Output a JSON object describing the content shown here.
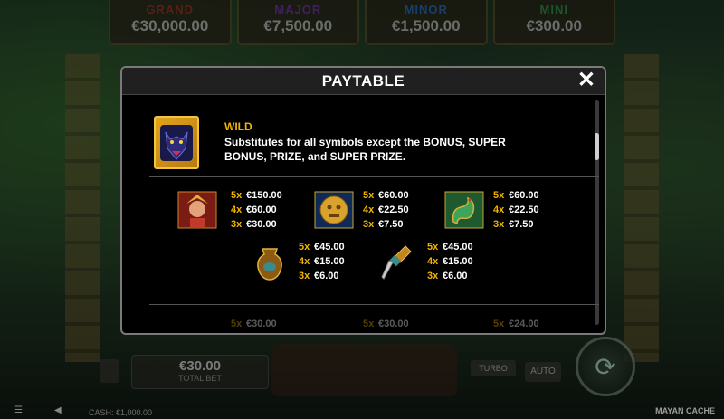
{
  "jackpots": [
    {
      "name": "GRAND",
      "value": "€30,000.00",
      "color": "#b0281d"
    },
    {
      "name": "MAJOR",
      "value": "€7,500.00",
      "color": "#7b2fb8"
    },
    {
      "name": "MINOR",
      "value": "€1,500.00",
      "color": "#2a6fd6"
    },
    {
      "name": "MINI",
      "value": "€300.00",
      "color": "#2ea14a"
    }
  ],
  "paytable": {
    "title": "PAYTABLE",
    "close_symbol": "✕",
    "wild": {
      "title": "WILD",
      "description": "Substitutes for all symbols except the BONUS, SUPER BONUS, PRIZE, and SUPER PRIZE.",
      "icon": "panther-icon"
    },
    "symbols": [
      {
        "icon": "queen-icon",
        "pays": [
          {
            "n": "5x",
            "v": "€150.00"
          },
          {
            "n": "4x",
            "v": "€60.00"
          },
          {
            "n": "3x",
            "v": "€30.00"
          }
        ]
      },
      {
        "icon": "gold-mask-icon",
        "pays": [
          {
            "n": "5x",
            "v": "€60.00"
          },
          {
            "n": "4x",
            "v": "€22.50"
          },
          {
            "n": "3x",
            "v": "€7.50"
          }
        ]
      },
      {
        "icon": "jade-snake-icon",
        "pays": [
          {
            "n": "5x",
            "v": "€60.00"
          },
          {
            "n": "4x",
            "v": "€22.50"
          },
          {
            "n": "3x",
            "v": "€7.50"
          }
        ]
      },
      {
        "icon": "vase-icon",
        "pays": [
          {
            "n": "5x",
            "v": "€45.00"
          },
          {
            "n": "4x",
            "v": "€15.00"
          },
          {
            "n": "3x",
            "v": "€6.00"
          }
        ]
      },
      {
        "icon": "dagger-icon",
        "pays": [
          {
            "n": "5x",
            "v": "€45.00"
          },
          {
            "n": "4x",
            "v": "€15.00"
          },
          {
            "n": "3x",
            "v": "€6.00"
          }
        ]
      }
    ],
    "next_row": [
      {
        "n": "5x",
        "v": "€30.00"
      },
      {
        "n": "5x",
        "v": "€30.00"
      },
      {
        "n": "5x",
        "v": "€24.00"
      }
    ]
  },
  "bottom_bar": {
    "bet_value": "€30.00",
    "bet_label": "TOTAL BET",
    "turbo_label": "TURBO",
    "auto_label": "AUTO",
    "cash": "CASH: €1,000.00",
    "game_name": "MAYAN CACHE"
  },
  "colors": {
    "accent": "#f0b400",
    "modal_bg": "#000000"
  }
}
